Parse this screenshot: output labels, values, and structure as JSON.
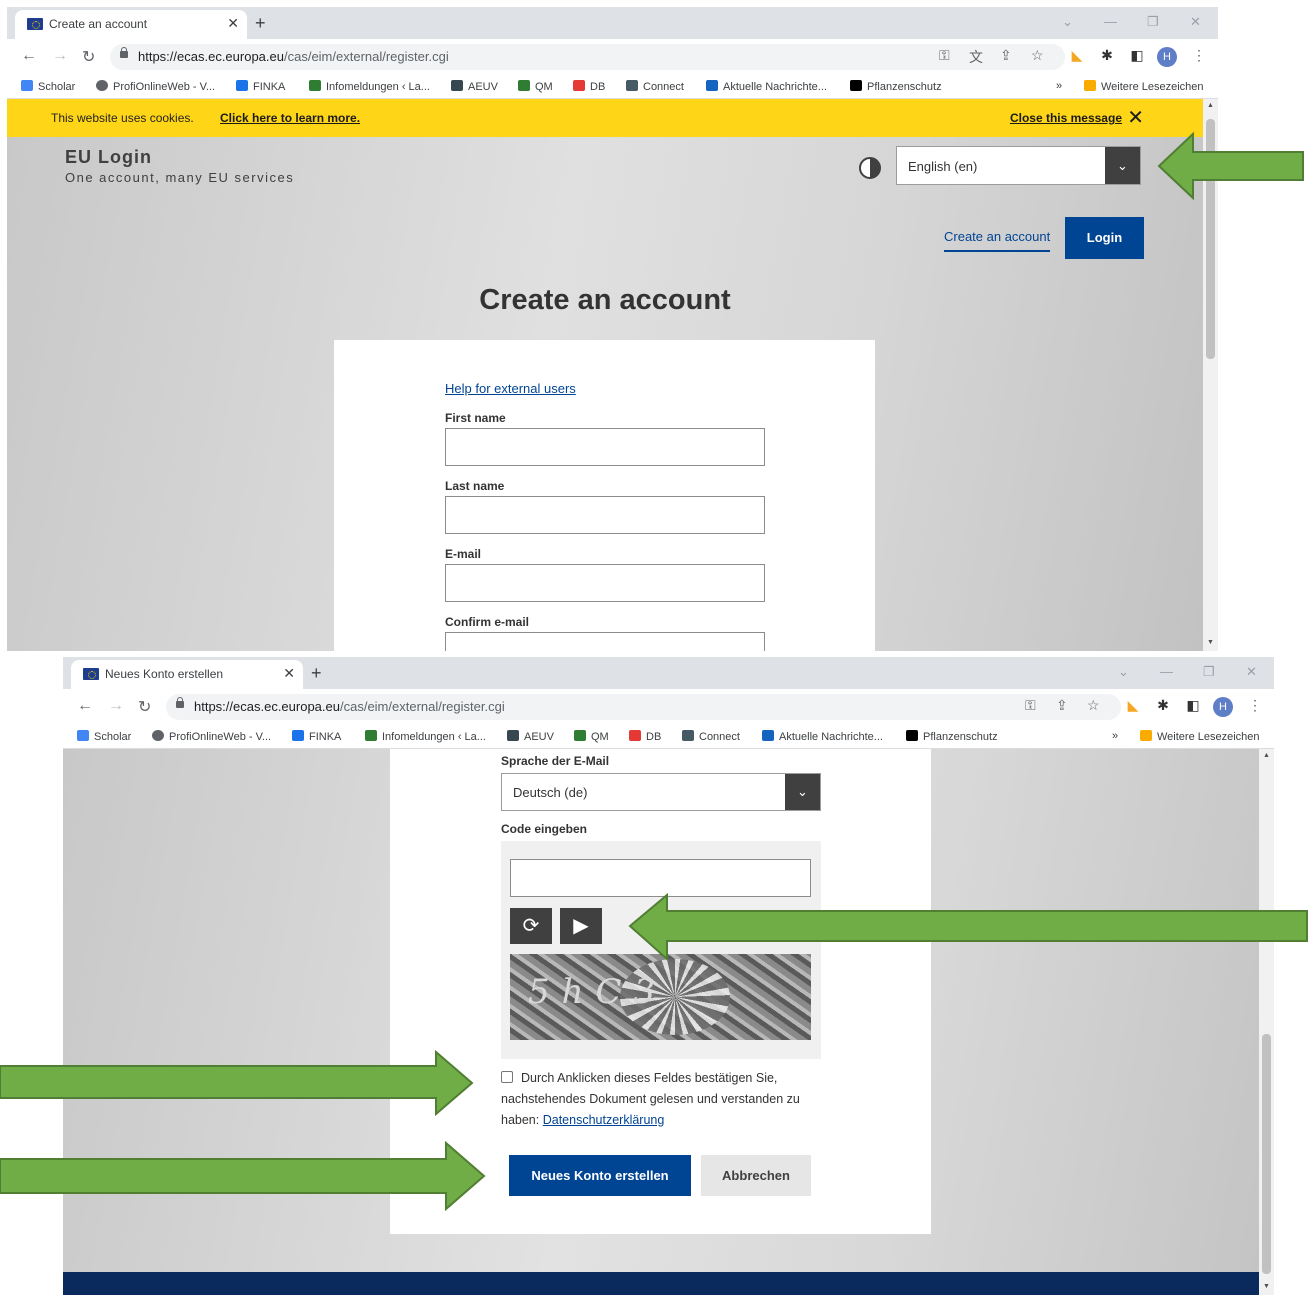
{
  "screenshot_top": {
    "tab_title": "Create an account",
    "url_host": "https://ecas.ec.europa.eu",
    "url_path": "/cas/eim/external/register.cgi",
    "bookmarks": [
      "Scholar",
      "ProfiOnlineWeb - V...",
      "FINKA",
      "Infomeldungen ‹ La...",
      "AEUV",
      "QM",
      "DB",
      "Connect",
      "Aktuelle Nachrichte...",
      "Pflanzenschutz"
    ],
    "bookmarks_more": "»",
    "bookmarks_other": "Weitere Lesezeichen",
    "avatar_letter": "H",
    "cookie_message": "This website uses cookies.",
    "cookie_learn_more": "Click here to learn more.",
    "cookie_close": "Close this message",
    "brand_title": "EU Login",
    "brand_tagline": "One account, many EU services",
    "language_selected": "English (en)",
    "create_account_link": "Create an account",
    "login_button": "Login",
    "page_heading": "Create an account",
    "help_link": "Help for external users",
    "fields": [
      "First name",
      "Last name",
      "E-mail",
      "Confirm e-mail"
    ]
  },
  "screenshot_bottom": {
    "tab_title": "Neues Konto erstellen",
    "url_host": "https://ecas.ec.europa.eu",
    "url_path": "/cas/eim/external/register.cgi",
    "avatar_letter": "H",
    "email_language_label": "Sprache der E-Mail",
    "email_language_value": "Deutsch (de)",
    "code_label": "Code eingeben",
    "captcha_text": "5hC3",
    "consent_text": "Durch Anklicken dieses Feldes bestätigen Sie, nachstehendes Dokument gelesen und verstanden zu haben:",
    "privacy_link": "Datenschutzerklärung",
    "create_button": "Neues Konto erstellen",
    "cancel_button": "Abbrechen"
  },
  "colors": {
    "accent_blue": "#004494",
    "cookie_yellow": "#ffd617",
    "arrow_green": "#70ad47",
    "arrow_border": "#507e32",
    "dark_gray": "#404040"
  }
}
